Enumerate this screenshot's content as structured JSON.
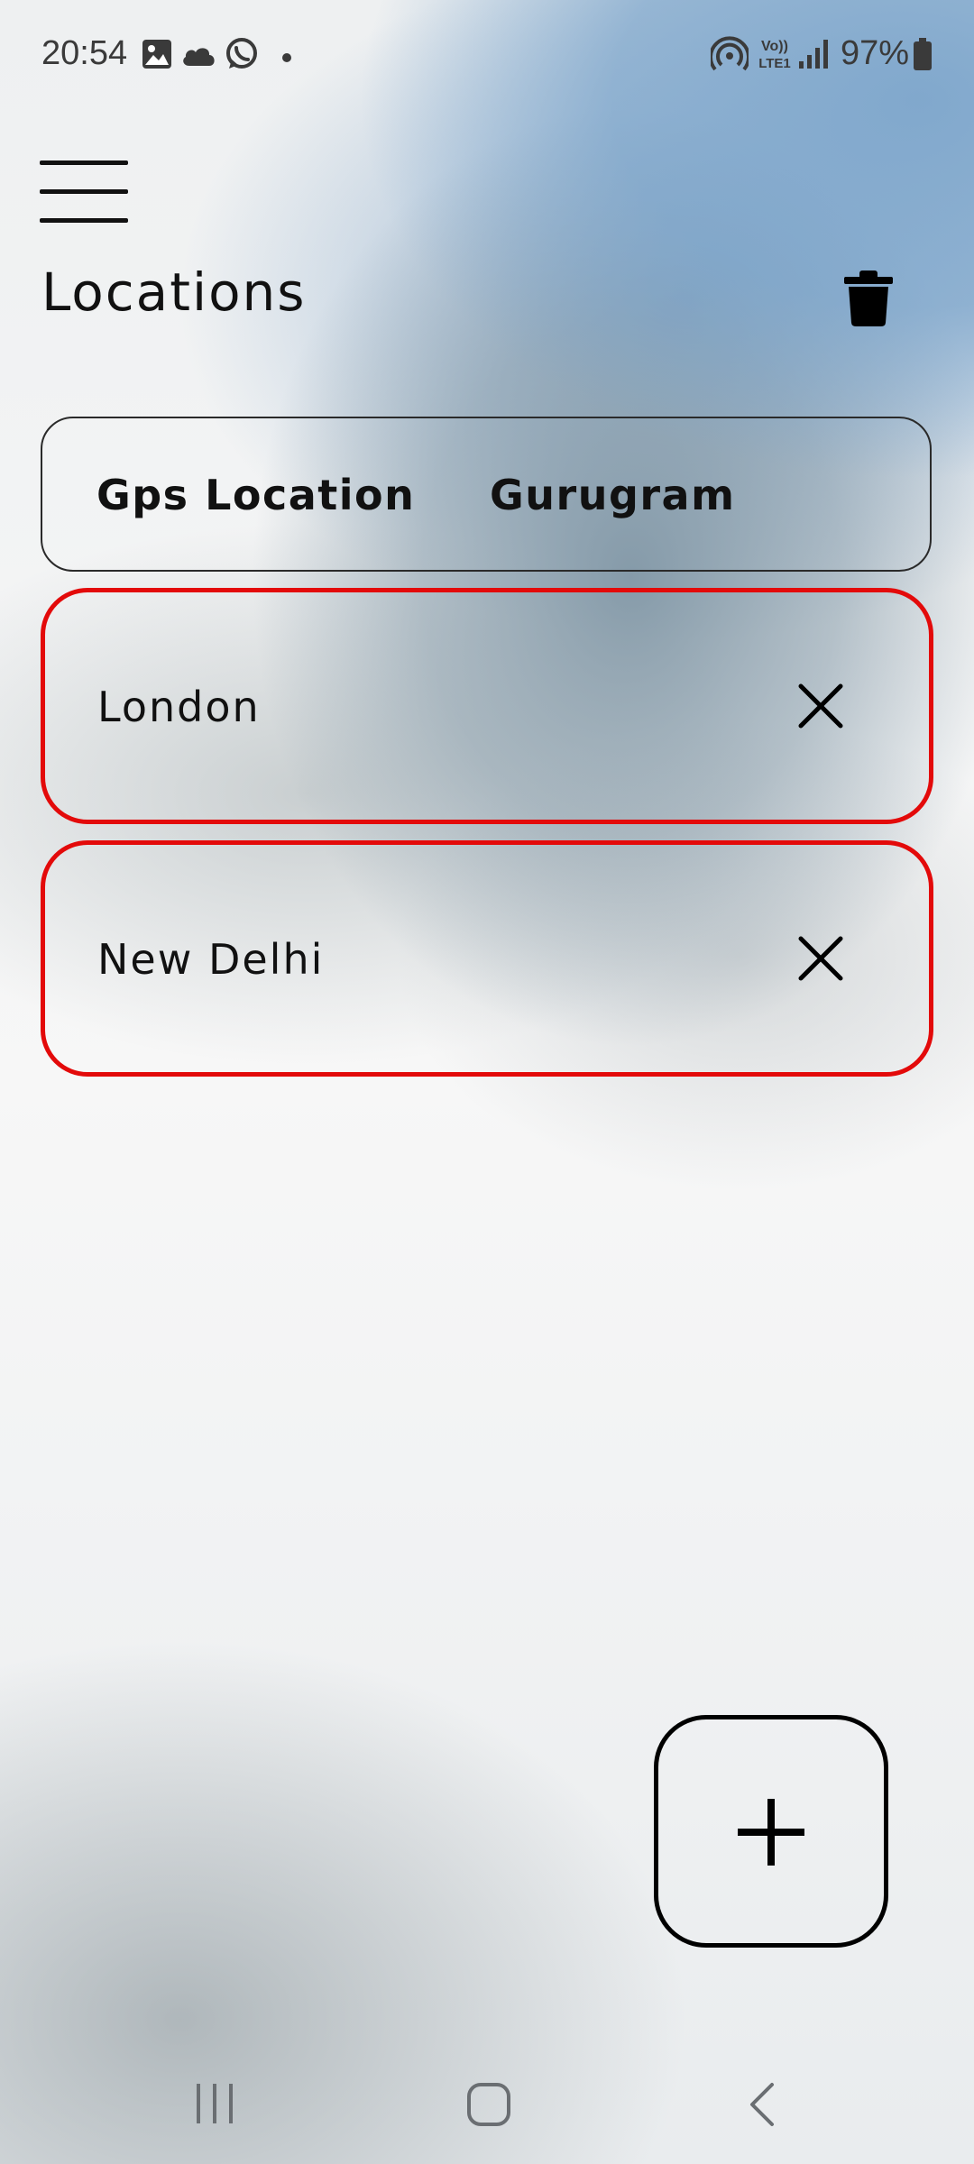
{
  "status_bar": {
    "time": "20:54",
    "battery": "97%",
    "notification_icons": [
      "gallery-icon",
      "cloud-icon",
      "whatsapp-icon",
      "dot-icon"
    ],
    "system_icons": [
      "hotspot-icon",
      "volte-icon",
      "signal-icon",
      "battery-icon"
    ],
    "volte_text": "Vo)) LTE1"
  },
  "header": {
    "title": "Locations",
    "menu_icon": "hamburger-menu-icon",
    "delete_icon": "trash-icon"
  },
  "gps": {
    "label": "Gps Location",
    "city": "Gurugram"
  },
  "saved_locations": [
    {
      "name": "London",
      "remove_icon": "close-icon"
    },
    {
      "name": "New Delhi",
      "remove_icon": "close-icon"
    }
  ],
  "add_button": {
    "icon": "plus-icon"
  },
  "nav_bar": {
    "buttons": [
      "recent-apps-icon",
      "home-icon",
      "back-icon"
    ]
  },
  "colors": {
    "accent_border": "#e30a0a",
    "text": "#111111",
    "sky_blue": "#7ca5cb"
  }
}
